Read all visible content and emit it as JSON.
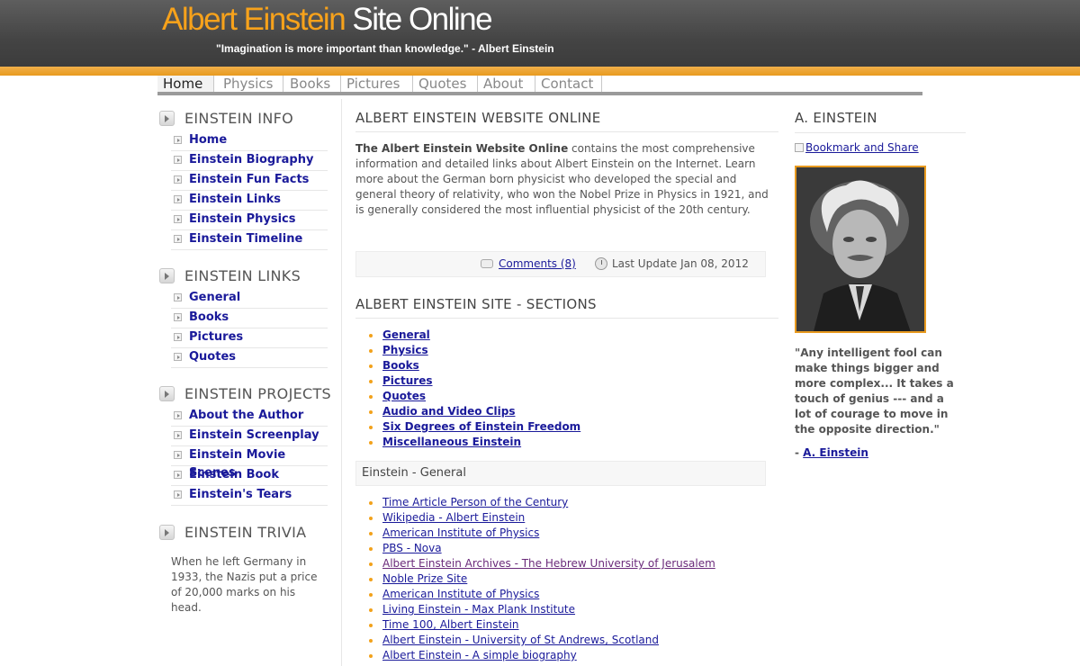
{
  "header": {
    "title_part1": "Albert Einstein",
    "title_part2": "Site Online",
    "tagline": "\"Imagination is more important than knowledge.\" - Albert Einstein"
  },
  "nav": {
    "items": [
      "Home",
      "Physics",
      "Books",
      "Pictures",
      "Quotes",
      "About",
      "Contact"
    ],
    "active": "Home"
  },
  "sidebar": {
    "info": {
      "title": "EINSTEIN INFO",
      "items": [
        "Home",
        "Einstein Biography",
        "Einstein Fun Facts",
        "Einstein Links",
        "Einstein Physics",
        "Einstein Timeline"
      ]
    },
    "links": {
      "title": "EINSTEIN LINKS",
      "items": [
        "General",
        "Books",
        "Pictures",
        "Quotes"
      ]
    },
    "projects": {
      "title": "EINSTEIN PROJECTS",
      "items": [
        "About the Author",
        "Einstein Screenplay",
        "Einstein Movie Scenes",
        "Einstein Book",
        "Einstein's Tears"
      ]
    },
    "trivia": {
      "title": "EINSTEIN TRIVIA",
      "text": "When he left Germany in 1933, the Nazis put a price of 20,000 marks on his head."
    }
  },
  "main": {
    "title": "ALBERT EINSTEIN WEBSITE ONLINE",
    "intro_bold": "The Albert Einstein Website Online",
    "intro_rest": " contains the most comprehensive information and detailed links about Albert Einstein on the Internet. Learn more about the German born physicist who developed the special and general theory of relativity, who won the Nobel Prize in Physics in 1921, and is generally considered the most influential physicist of the 20th century.",
    "comments": "Comments (8)",
    "last_update": "Last Update Jan 08, 2012",
    "sections_title": "ALBERT EINSTEIN SITE - SECTIONS",
    "sections": [
      "General",
      "Physics",
      "Books",
      "Pictures",
      "Quotes",
      "Audio and Video Clips",
      "Six Degrees of Einstein Freedom",
      "Miscellaneous Einstein"
    ],
    "general_title": "Einstein - General",
    "general_links": [
      "Time Article Person of the Century",
      "Wikipedia - Albert Einstein",
      "American Institute of Physics",
      "PBS - Nova",
      "Albert Einstein Archives - The Hebrew University of Jerusalem",
      "Noble Prize Site",
      "American Institute of Physics",
      "Living Einstein - Max Plank Institute",
      "Time 100, Albert Einstein",
      "Albert Einstein - University of St Andrews, Scotland",
      "Albert Einstein - A simple biography"
    ]
  },
  "right": {
    "title": "A. EINSTEIN",
    "bookmark": "Bookmark and Share",
    "quote": "\"Any intelligent fool can make things bigger and more complex... It takes a touch of genius --- and a lot of courage to move in the opposite direction.\"",
    "quote_dash": "- ",
    "quote_author": "A. Einstein"
  }
}
